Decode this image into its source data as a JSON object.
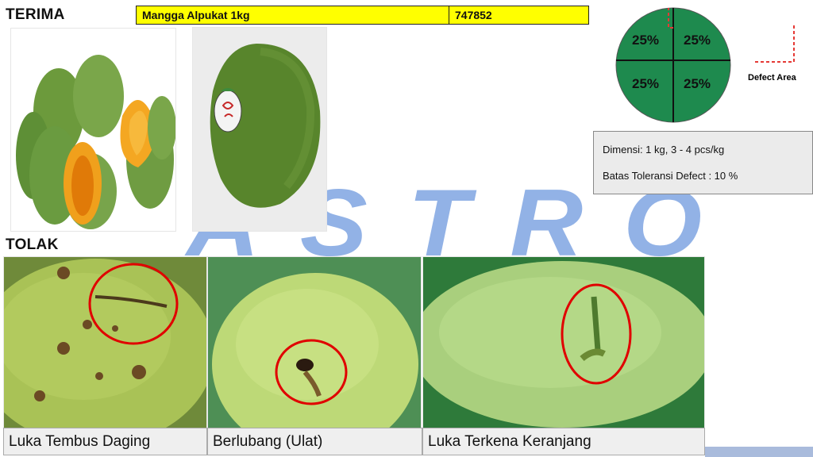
{
  "accept_section": {
    "title": "TERIMA"
  },
  "reject_section": {
    "title": "TOLAK"
  },
  "product": {
    "name": "Mangga Alpukat 1kg",
    "code": "747852"
  },
  "defect_diagram": {
    "quadrants": [
      "25%",
      "25%",
      "25%",
      "25%"
    ],
    "legend_label": "Defect Area",
    "colors": {
      "circle": "#1e8a4e",
      "defect_marker": "#e53935"
    }
  },
  "specs": {
    "dimension": "Dimensi: 1 kg, 3 - 4 pcs/kg",
    "tolerance": "Batas Toleransi Defect : 10 %"
  },
  "reject_items": [
    {
      "caption": "Luka Tembus Daging"
    },
    {
      "caption": "Berlubang (Ulat)"
    },
    {
      "caption": "Luka Terkena Keranjang"
    }
  ],
  "watermark": {
    "text": "ASTRO",
    "color": "#4a7fd6"
  }
}
